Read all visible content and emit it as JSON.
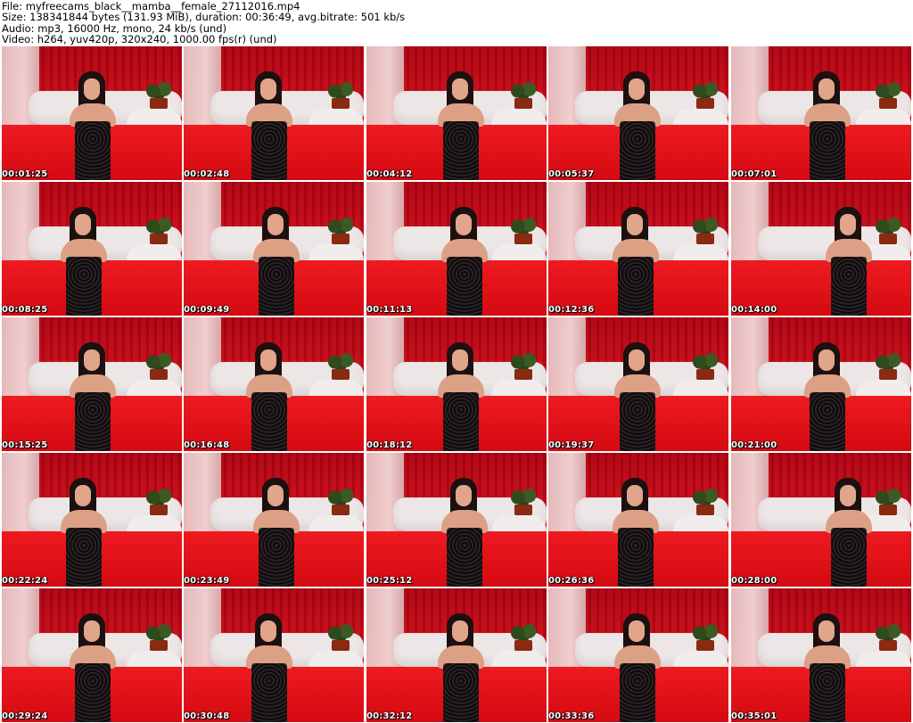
{
  "header": {
    "line1": "File: myfreecams_black__mamba__female_27112016.mp4",
    "line2": "Size: 138341844 bytes (131.93 MiB), duration: 00:36:49, avg.bitrate: 501 kb/s",
    "line3": "Audio: mp3, 16000 Hz, mono, 24 kb/s (und)",
    "line4": "Video: h264, yuv420p, 320x240, 1000.00 fps(r) (und)"
  },
  "thumbnails": [
    {
      "timestamp": "00:01:25"
    },
    {
      "timestamp": "00:02:48"
    },
    {
      "timestamp": "00:04:12"
    },
    {
      "timestamp": "00:05:37"
    },
    {
      "timestamp": "00:07:01"
    },
    {
      "timestamp": "00:08:25"
    },
    {
      "timestamp": "00:09:49"
    },
    {
      "timestamp": "00:11:13"
    },
    {
      "timestamp": "00:12:36"
    },
    {
      "timestamp": "00:14:00"
    },
    {
      "timestamp": "00:15:25"
    },
    {
      "timestamp": "00:16:48"
    },
    {
      "timestamp": "00:18:12"
    },
    {
      "timestamp": "00:19:37"
    },
    {
      "timestamp": "00:21:00"
    },
    {
      "timestamp": "00:22:24"
    },
    {
      "timestamp": "00:23:49"
    },
    {
      "timestamp": "00:25:12"
    },
    {
      "timestamp": "00:26:36"
    },
    {
      "timestamp": "00:28:00"
    },
    {
      "timestamp": "00:29:24"
    },
    {
      "timestamp": "00:30:48"
    },
    {
      "timestamp": "00:32:12"
    },
    {
      "timestamp": "00:33:36"
    },
    {
      "timestamp": "00:35:01"
    }
  ],
  "colors": {
    "background": "#ffffff",
    "timestamp_text": "#ffffff",
    "curtain_red": "#c8000d"
  }
}
